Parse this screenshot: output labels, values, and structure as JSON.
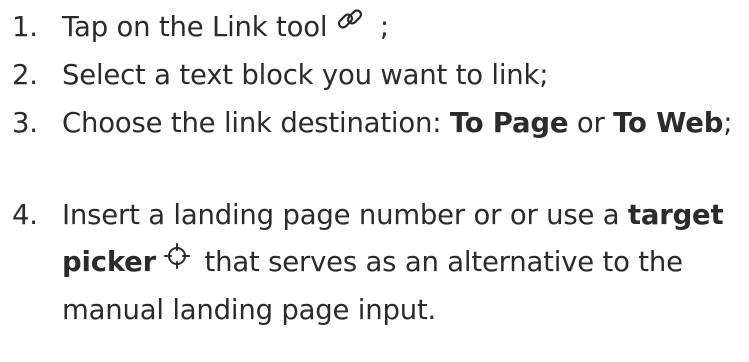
{
  "steps": [
    {
      "number": "1.",
      "text_before": "Tap on the Link tool",
      "icon": "link-icon",
      "text_after": " ;"
    },
    {
      "number": "2.",
      "text": "Select a text block you want to link;"
    },
    {
      "number": "3.",
      "text_before": "Choose the link destination: ",
      "bold1": "To Page",
      "text_middle": " or ",
      "bold2": "To Web",
      "text_after": ";"
    },
    {
      "number": "4.",
      "text_before": "Insert a landing page number or or use a ",
      "bold": "target picker",
      "icon": "crosshair-icon",
      "text_after": " that serves as an alternative to the manual landing page input."
    }
  ]
}
